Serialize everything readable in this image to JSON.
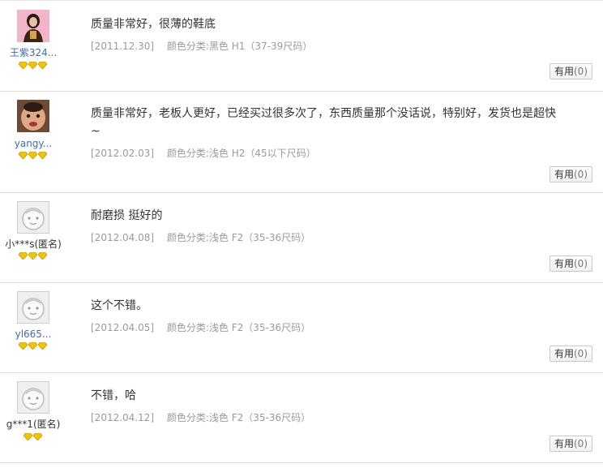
{
  "reviews": [
    {
      "username": "王紫324...",
      "avatar_type": "photo-girl",
      "rank_count": 3,
      "content": "质量非常好，很薄的鞋底",
      "date": "[2011.12.30]",
      "sku": "颜色分类:黑色 H1（37-39尺码）",
      "useful_label": "有用",
      "useful_count": "(0)"
    },
    {
      "username": "yangy...",
      "avatar_type": "photo-baby",
      "rank_count": 3,
      "content": "质量非常好，老板人更好，已经买过很多次了，东西质量那个没话说，特别好，发货也是超快~",
      "date": "[2012.02.03]",
      "sku": "颜色分类:浅色 H2（45以下尺码）",
      "useful_label": "有用",
      "useful_count": "(0)"
    },
    {
      "username": "小***s(匿名)",
      "avatar_type": "default",
      "rank_count": 3,
      "content": "耐磨损 挺好的",
      "date": "[2012.04.08]",
      "sku": "颜色分类:浅色 F2（35-36尺码）",
      "useful_label": "有用",
      "useful_count": "(0)"
    },
    {
      "username": "yl665...",
      "avatar_type": "default",
      "rank_count": 3,
      "content": "这个不错。",
      "date": "[2012.04.05]",
      "sku": "颜色分类:浅色 F2（35-36尺码）",
      "useful_label": "有用",
      "useful_count": "(0)"
    },
    {
      "username": "g***1(匿名)",
      "avatar_type": "default",
      "rank_count": 2,
      "content": "不错，哈",
      "date": "[2012.04.12]",
      "sku": "颜色分类:浅色 F2（35-36尺码）",
      "useful_label": "有用",
      "useful_count": "(0)"
    }
  ],
  "colors": {
    "username_link": "#3e6bb8",
    "meta_gray": "#9a9a9a",
    "diamond_gold": "#f5c400"
  }
}
